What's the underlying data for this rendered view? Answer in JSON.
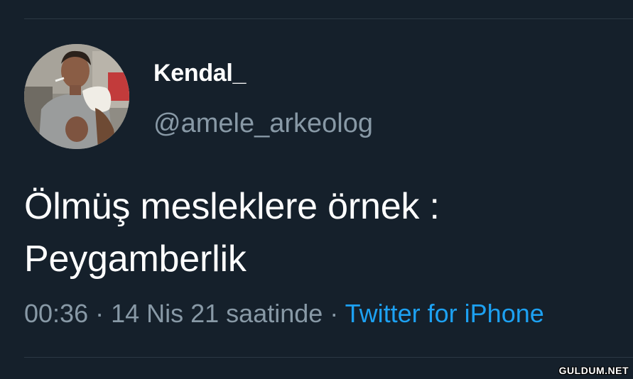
{
  "tweet": {
    "author": {
      "display_name": "Kendal_",
      "handle": "@amele_arkeolog"
    },
    "text_lines": [
      "Ölmüş mesleklere örnek :",
      "Peygamberlik"
    ],
    "time": "00:36",
    "separator": " · ",
    "date": "14 Nis 21 saatinde",
    "source": "Twitter for iPhone"
  },
  "watermark": "GULDUM.NET",
  "colors": {
    "background": "#15202b",
    "primary_text": "#ffffff",
    "secondary_text": "#8899a6",
    "accent": "#1da1f2",
    "divider": "#2b3844"
  }
}
